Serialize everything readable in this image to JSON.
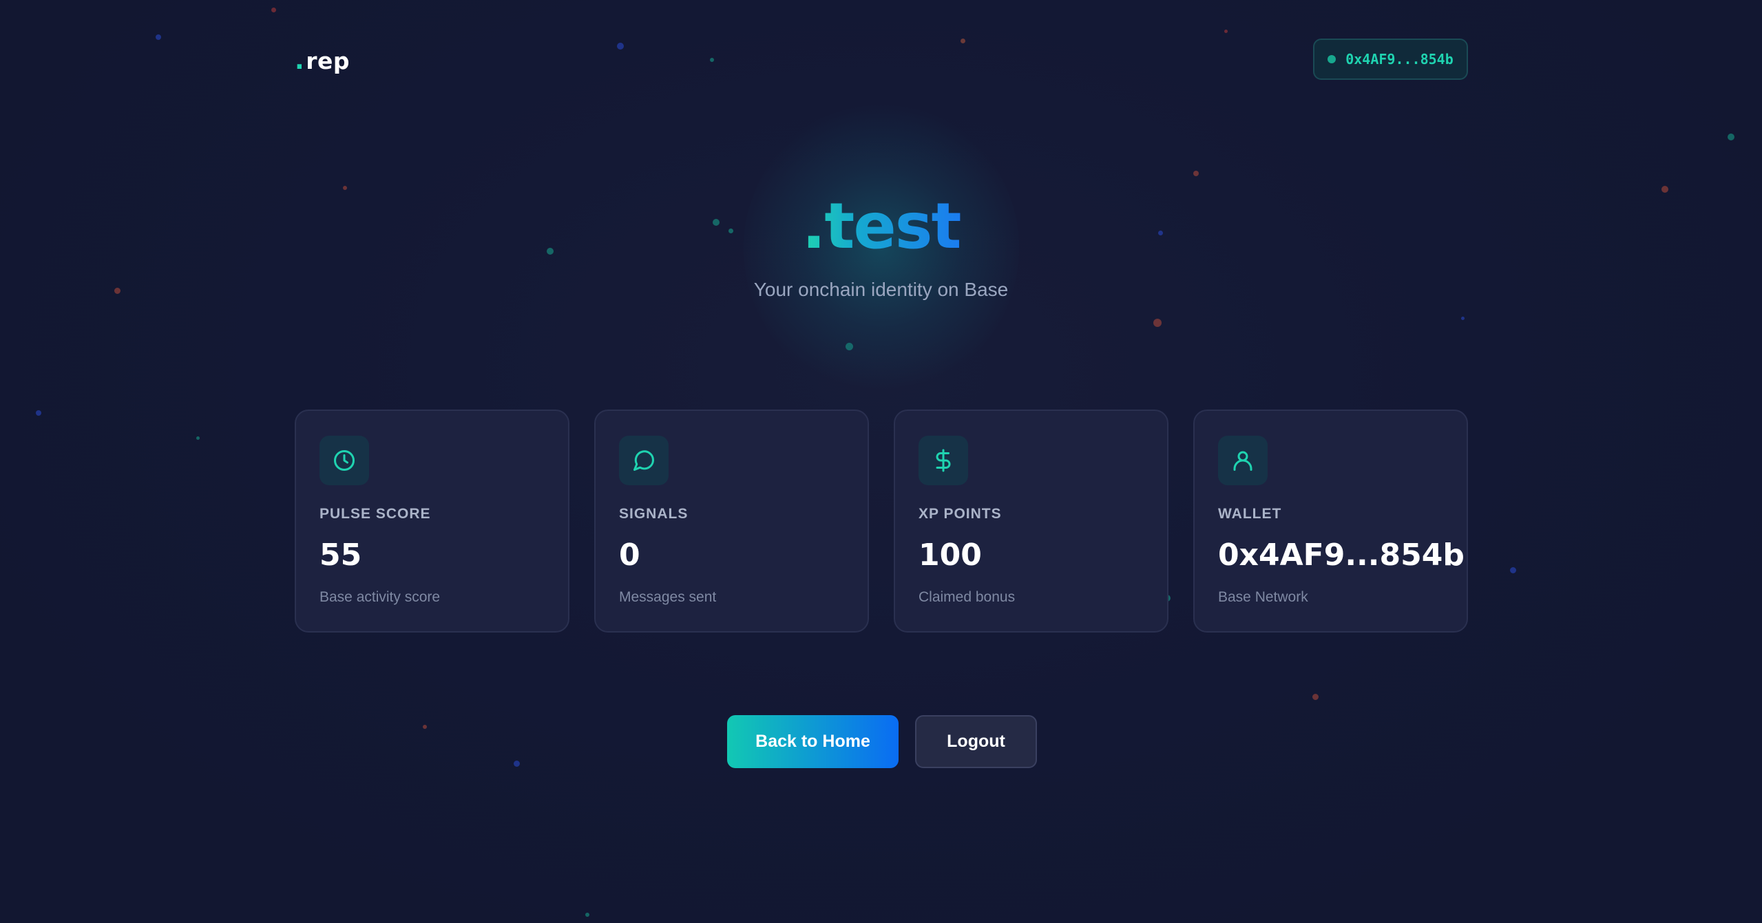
{
  "header": {
    "logo_dot": ".",
    "logo_text": "rep",
    "wallet_chip": "0x4AF9...854b"
  },
  "hero": {
    "title": ".test",
    "subtitle": "Your onchain identity on Base"
  },
  "cards": [
    {
      "icon": "clock-icon",
      "label": "PULSE SCORE",
      "value": "55",
      "desc": "Base activity score"
    },
    {
      "icon": "message-icon",
      "label": "SIGNALS",
      "value": "0",
      "desc": "Messages sent"
    },
    {
      "icon": "dollar-icon",
      "label": "XP POINTS",
      "value": "100",
      "desc": "Claimed bonus"
    },
    {
      "icon": "user-icon",
      "label": "WALLET",
      "value": "0x4AF9...854b",
      "desc": "Base Network"
    }
  ],
  "actions": {
    "back_home": "Back to Home",
    "logout": "Logout"
  },
  "colors": {
    "accent": "#1fd3b0",
    "accent_blue": "#0a6cf3",
    "background": "#151a33",
    "card": "#1d2240"
  }
}
